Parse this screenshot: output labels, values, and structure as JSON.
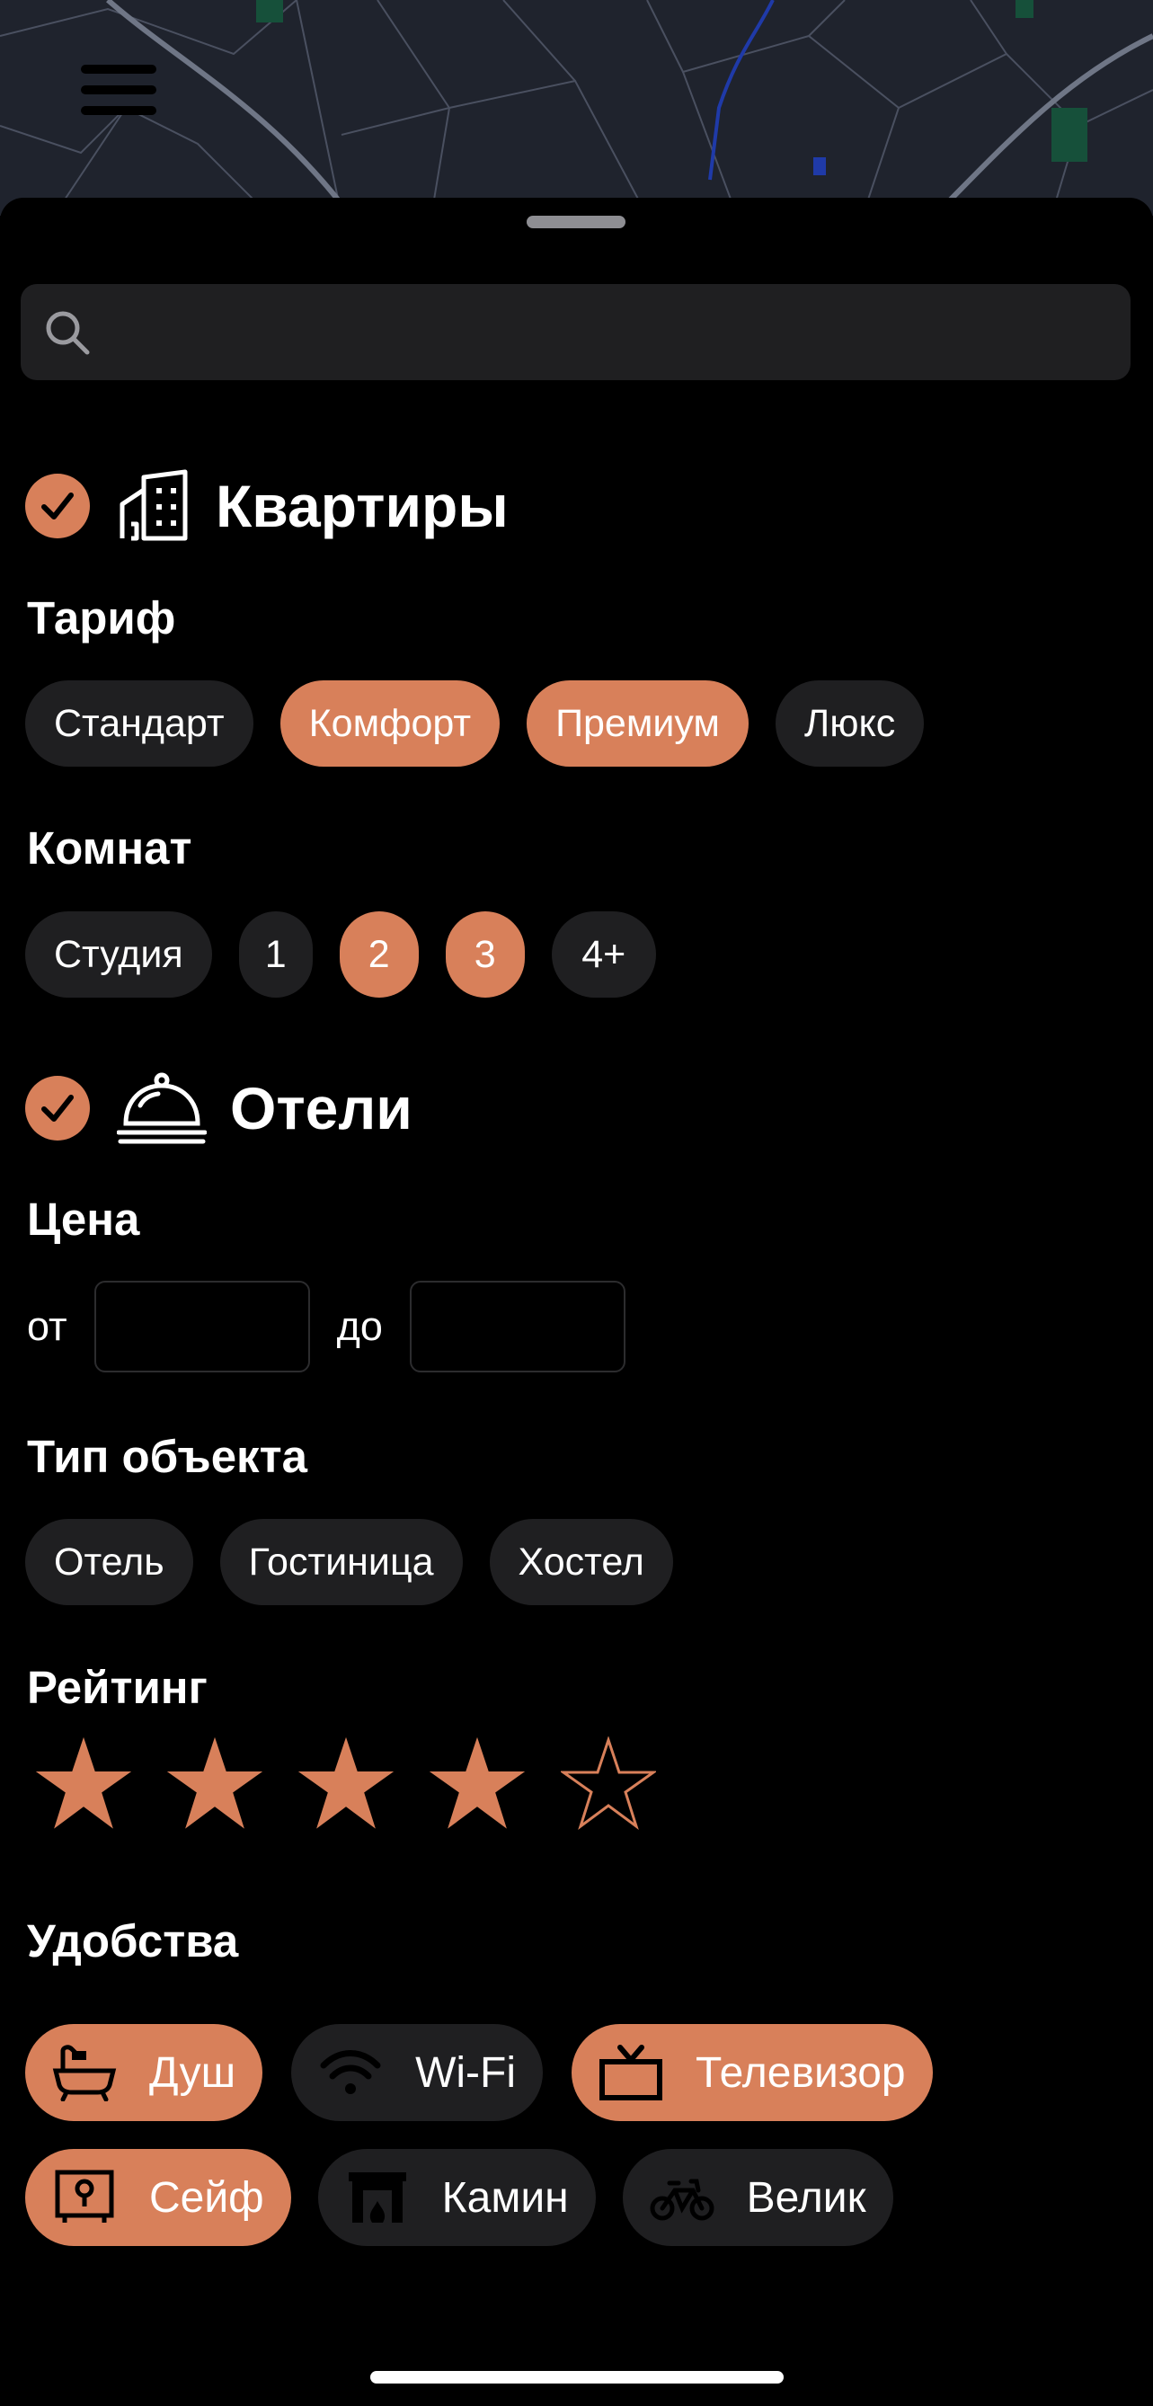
{
  "colors": {
    "accent": "#d8805a",
    "chip": "#1f1f21",
    "background": "#000000"
  },
  "search": {
    "placeholder": ""
  },
  "apartments": {
    "title": "Квартиры",
    "icon": "building-icon",
    "checked": true,
    "tariff_label": "Тариф",
    "tariffs": [
      {
        "label": "Стандарт",
        "selected": false
      },
      {
        "label": "Комфорт",
        "selected": true
      },
      {
        "label": "Премиум",
        "selected": true
      },
      {
        "label": "Люкс",
        "selected": false
      }
    ],
    "rooms_label": "Комнат",
    "rooms": [
      {
        "label": "Студия",
        "selected": false
      },
      {
        "label": "1",
        "selected": false
      },
      {
        "label": "2",
        "selected": true
      },
      {
        "label": "3",
        "selected": true
      },
      {
        "label": "4+",
        "selected": false
      }
    ]
  },
  "hotels": {
    "title": "Отели",
    "icon": "cloche-icon",
    "checked": true,
    "price_label": "Цена",
    "price_from_label": "от",
    "price_to_label": "до",
    "price_from_value": "",
    "price_to_value": "",
    "type_label": "Тип объекта",
    "types": [
      {
        "label": "Отель",
        "selected": false
      },
      {
        "label": "Гостиница",
        "selected": false
      },
      {
        "label": "Хостел",
        "selected": false
      }
    ],
    "rating_label": "Рейтинг",
    "rating": 4,
    "rating_max": 5,
    "amenities_label": "Удобства",
    "amenities": [
      {
        "label": "Душ",
        "icon": "bathtub-icon",
        "selected": true
      },
      {
        "label": "Wi-Fi",
        "icon": "wifi-icon",
        "selected": false
      },
      {
        "label": "Телевизор",
        "icon": "tv-icon",
        "selected": true
      },
      {
        "label": "Сейф",
        "icon": "safe-icon",
        "selected": true
      },
      {
        "label": "Камин",
        "icon": "fireplace-icon",
        "selected": false
      },
      {
        "label": "Велик",
        "icon": "bicycle-icon",
        "selected": false
      }
    ]
  }
}
